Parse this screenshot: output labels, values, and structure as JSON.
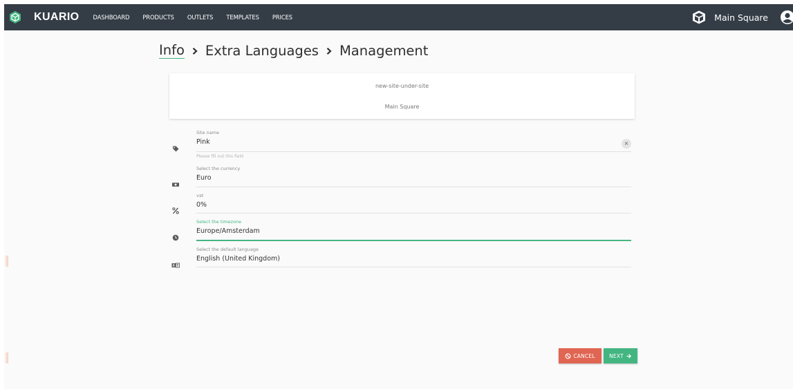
{
  "app": {
    "brand": "KUARIO"
  },
  "nav": {
    "items": [
      "DASHBOARD",
      "PRODUCTS",
      "OUTLETS",
      "TEMPLATES",
      "PRICES"
    ]
  },
  "header": {
    "location": "Main Square"
  },
  "breadcrumb": {
    "items": [
      "Info",
      "Extra Languages",
      "Management"
    ]
  },
  "info_card": {
    "line1": "new-site-under-site",
    "line2": "Main Square"
  },
  "form": {
    "site_name": {
      "label": "Site name",
      "value": "Pink",
      "hint": "Please fill out this field",
      "clear_glyph": "×"
    },
    "currency": {
      "label": "Select the currency",
      "value": "Euro"
    },
    "vat": {
      "label": "vat",
      "value": "0%"
    },
    "timezone": {
      "label": "Select the timezone",
      "value": "Europe/Amsterdam"
    },
    "language": {
      "label": "Select the default language",
      "value": "English (United Kingdom)"
    }
  },
  "actions": {
    "cancel_label": "CANCEL",
    "next_label": "NEXT"
  },
  "icons": {
    "brand": "kuario-logo-icon",
    "location": "cube-icon",
    "user": "user-circle-icon",
    "breadcrumb_separator": "chevron-right-icon",
    "site_name": "tag-icon",
    "currency": "money-icon",
    "vat": "percent-icon",
    "timezone": "clock-icon",
    "language": "translate-icon",
    "cancel": "ban-icon",
    "next": "arrow-right-icon"
  },
  "colors": {
    "topbar": "#343d46",
    "accent": "#43b581",
    "cancel": "#e06552",
    "background": "#fafafa"
  }
}
